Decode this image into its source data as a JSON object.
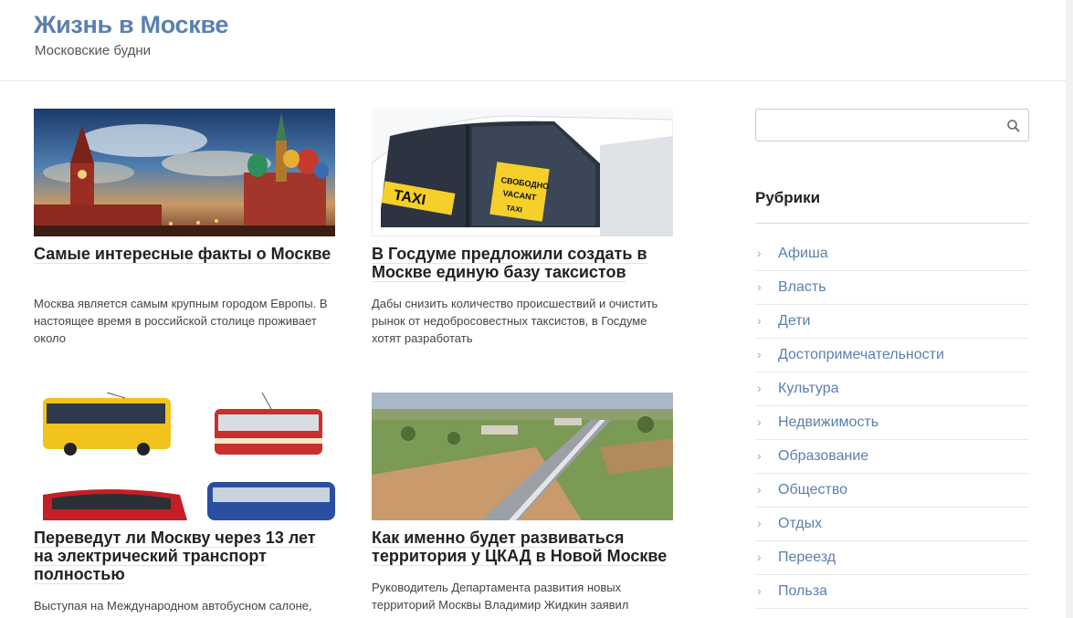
{
  "site": {
    "title": "Жизнь в Москве",
    "description": "Московские будни"
  },
  "posts": [
    {
      "title": "Самые интересные факты о Москве",
      "excerpt": "Москва является самым крупным городом Европы. В настоящее время в российской столице проживает около",
      "image": "kremlin-photo"
    },
    {
      "title": "В Госдуме предложили создать в Москве единую базу таксистов",
      "excerpt": "Дабы снизить количество происшествий и очистить рынок от недобросовестных таксистов, в Госдуме хотят разработать",
      "image": "taxi-photo",
      "image_text": {
        "taxi": "TAXI",
        "sign_line1": "СВОБОДНО",
        "sign_line2": "VACANT",
        "sign_line3": "TAXI"
      }
    },
    {
      "title": "Переведут ли Москву через 13 лет на электрический транспорт полностью",
      "excerpt": "Выступая на Международном автобусном салоне,",
      "image": "transport-photo"
    },
    {
      "title": "Как именно будет развиваться территория у ЦКАД в Новой Москве",
      "excerpt": "Руководитель Департамента развития новых территорий Москвы Владимир Жидкин заявил",
      "image": "highway-aerial-photo"
    }
  ],
  "sidebar": {
    "search": {
      "placeholder": "",
      "value": "",
      "icon": "search-icon"
    },
    "categories_title": "Рубрики",
    "categories": [
      "Афиша",
      "Власть",
      "Дети",
      "Достопримечательности",
      "Культура",
      "Недвижимость",
      "Образование",
      "Общество",
      "Отдых",
      "Переезд",
      "Польза"
    ],
    "chevron": "›"
  },
  "colors": {
    "link": "#5b7fb0",
    "title_text": "#222222",
    "taxi_yellow": "#f5cf2a"
  }
}
